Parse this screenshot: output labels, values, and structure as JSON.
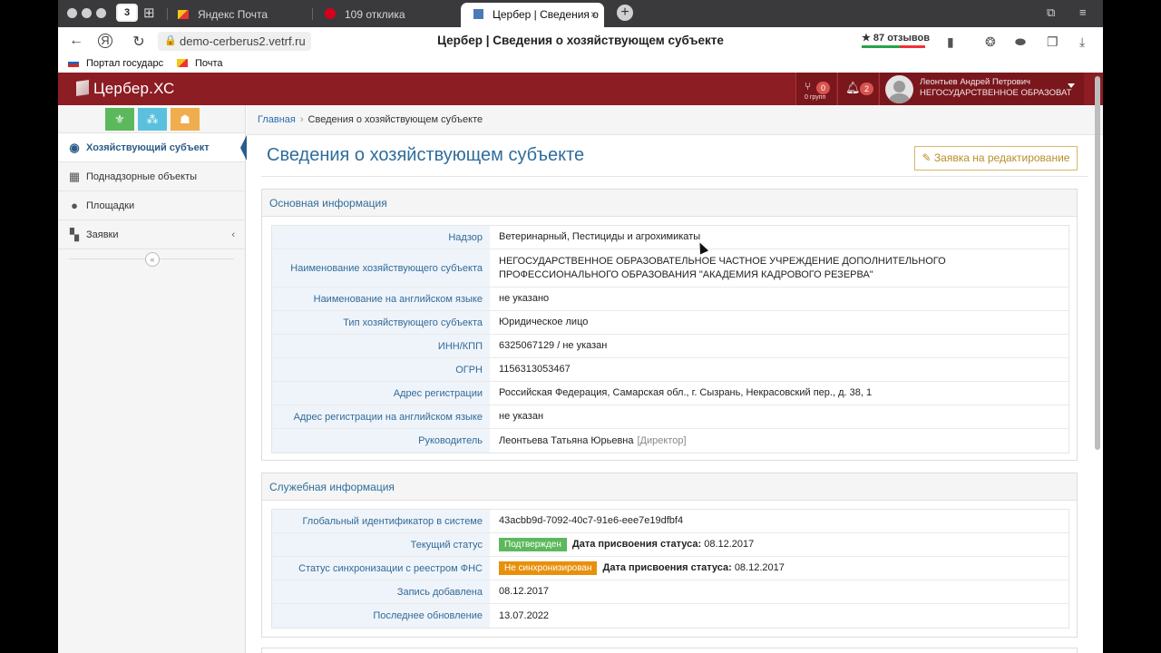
{
  "browser": {
    "tabs": [
      {
        "label": "Яндекс Почта",
        "active": false
      },
      {
        "label": "109 отклика",
        "active": false
      },
      {
        "label": "Цербер | Сведения о",
        "active": true
      }
    ],
    "tab_close": "×",
    "new_tab": "+",
    "url": "demo-cerberus2.vetrf.ru",
    "page_title": "Цербер | Сведения о хозяйствующем субъекте",
    "reviews": "★ 87 отзывов",
    "bookmarks": [
      "Портал государс",
      "Почта"
    ],
    "tab_count_badge": "3"
  },
  "app": {
    "logo_text": "Цербер.ХС",
    "groups_count": "0",
    "groups_label": "0 групп",
    "notifications_count": "2",
    "user_name": "Леонтьев Андрей Петрович",
    "user_org": "НЕГОСУДАРСТВЕННОЕ ОБРАЗОВАТ"
  },
  "sidebar": {
    "items": [
      {
        "label": "Хозяйствующий субъект",
        "icon": "person-icon",
        "active": true
      },
      {
        "label": "Поднадзорные объекты",
        "icon": "building-icon",
        "active": false
      },
      {
        "label": "Площадки",
        "icon": "map-marker-icon",
        "active": false
      },
      {
        "label": "Заявки",
        "icon": "puzzle-icon",
        "active": false
      }
    ],
    "collapse_symbol": "«"
  },
  "breadcrumb": {
    "home": "Главная",
    "current": "Сведения о хозяйствующем субъекте"
  },
  "page": {
    "title": "Сведения о хозяйствующем субъекте",
    "edit_button": "Заявка на редактирование"
  },
  "main_info": {
    "heading": "Основная информация",
    "rows": [
      {
        "label": "Надзор",
        "value": "Ветеринарный, Пестициды и агрохимикаты"
      },
      {
        "label": "Наименование хозяйствующего субъекта",
        "value": "НЕГОСУДАРСТВЕННОЕ ОБРАЗОВАТЕЛЬНОЕ ЧАСТНОЕ УЧРЕЖДЕНИЕ ДОПОЛНИТЕЛЬНОГО ПРОФЕССИОНАЛЬНОГО ОБРАЗОВАНИЯ \"АКАДЕМИЯ КАДРОВОГО РЕЗЕРВА\""
      },
      {
        "label": "Наименование на английском языке",
        "value": "не указано"
      },
      {
        "label": "Тип хозяйствующего субъекта",
        "value": "Юридическое лицо"
      },
      {
        "label": "ИНН/КПП",
        "value": "6325067129 / не указан"
      },
      {
        "label": "ОГРН",
        "value": "1156313053467"
      },
      {
        "label": "Адрес регистрации",
        "value": "Российская Федерация, Самарская обл., г. Сызрань, Некрасовский пер., д. 38, 1"
      },
      {
        "label": "Адрес регистрации на английском языке",
        "value": "не указан"
      },
      {
        "label": "Руководитель",
        "value": "Леонтьева Татьяна Юрьевна",
        "role": "[Директор]"
      }
    ]
  },
  "service_info": {
    "heading": "Служебная информация",
    "guid_label": "Глобальный идентификатор в системе",
    "guid": "43acbb9d-7092-40c7-91e6-eee7e19dfbf4",
    "status_label": "Текущий статус",
    "status_badge": "Подтвержден",
    "status_date_label": "Дата присвоения статуса:",
    "status_date": "08.12.2017",
    "sync_label": "Статус синхронизации с реестром ФНС",
    "sync_badge": "Не синхронизирован",
    "sync_date_label": "Дата присвоения статуса:",
    "sync_date": "08.12.2017",
    "added_label": "Запись добавлена",
    "added": "08.12.2017",
    "updated_label": "Последнее обновление",
    "updated": "13.07.2022"
  },
  "colors": {
    "header": "#8b1d23",
    "accent": "#2f6d9c",
    "status_confirmed": "#5cb85c",
    "status_not_synced": "#e8900c",
    "edit_button": "#b98d2a"
  }
}
